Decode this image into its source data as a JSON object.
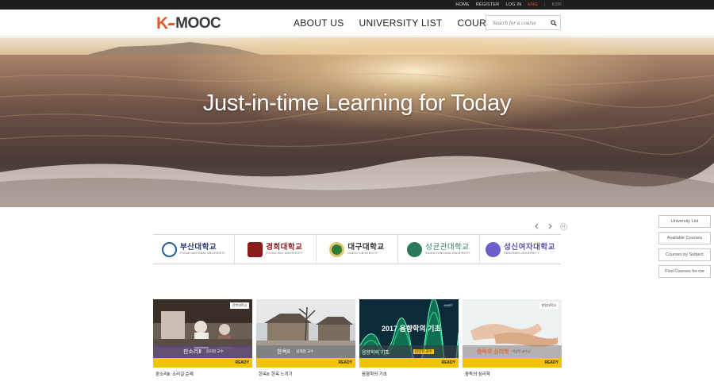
{
  "topbar": {
    "links": [
      "HOME",
      "REGISTER",
      "LOG IN"
    ],
    "lang_active": "ENG",
    "lang_other": "KOR",
    "separator": "|"
  },
  "header": {
    "logo_k": "K",
    "logo_rest": "MOOC",
    "nav": [
      "ABOUT US",
      "UNIVERSITY LIST",
      "COURSES"
    ],
    "search_placeholder": "Search for a course"
  },
  "hero": {
    "title": "Just-in-time Learning for Today"
  },
  "universities": [
    {
      "ko": "부산대학교",
      "en": "PUSAN NATIONAL UNIVERSITY",
      "color": "#1f5fa8"
    },
    {
      "ko": "경희대학교",
      "en": "KYUNG HEE UNIVERSITY",
      "color": "#8b1c1c"
    },
    {
      "ko": "대구대학교",
      "en": "DAEGU UNIVERSITY",
      "color": "#2f7a3a"
    },
    {
      "ko": "성균관대학교",
      "en": "SUNGKYUNKWAN UNIVERSITY",
      "color": "#2b7b5a"
    },
    {
      "ko": "성신여자대학교",
      "en": "SUNGSHIN UNIVERSITY",
      "color": "#5a4fb0"
    }
  ],
  "side_buttons": [
    "University List",
    "Available Courses",
    "Courses by Subject",
    "Find Courses for me"
  ],
  "courses": [
    {
      "caption_main": "판소리Ⅱ",
      "caption_sub": "김희정 교수",
      "status": "READY",
      "title": "판소리Ⅱ: 소리길 순례",
      "badge": "전북대학교"
    },
    {
      "caption_main": "한옥Ⅱ",
      "caption_sub": "남해정 교수",
      "status": "READY",
      "title": "한옥Ⅱ: 한옥 느끼기",
      "badge": ""
    },
    {
      "caption_main": "음향학의 기초",
      "caption_sub": "김양한 교수",
      "status": "READY",
      "title": "음향학의 기초",
      "badge": "KAIST",
      "overlay_text": "2017 음향학의 기초"
    },
    {
      "caption_main": "중독의 심리학",
      "caption_sub": "이상민 교수님",
      "status": "READY",
      "title": "중독의 심리학",
      "badge": "한림대학교"
    }
  ],
  "colors": {
    "brand_orange": "#e2582a",
    "ready_yellow": "#f0c400",
    "topbar": "#1e1e1e"
  }
}
